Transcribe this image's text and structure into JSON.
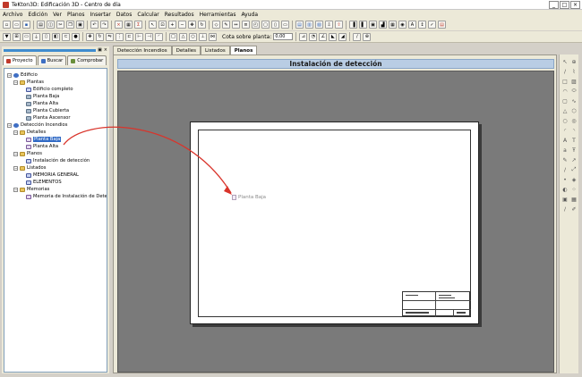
{
  "window": {
    "title": "TeKton3D: Edificación 3D - Centro de día",
    "buttons": [
      "_",
      "□",
      "×"
    ]
  },
  "menu": [
    "Archivo",
    "Edición",
    "Ver",
    "Planos",
    "Insertar",
    "Datos",
    "Calcular",
    "Resultados",
    "Herramientas",
    "Ayuda"
  ],
  "toolbar": {
    "cota_label": "Cota sobre planta:",
    "cota_value": "0,00"
  },
  "left_panel": {
    "tabs": [
      "Proyecto",
      "Buscar",
      "Comprobar"
    ],
    "tree": [
      {
        "label": "Edificio"
      },
      {
        "label": "Plantas"
      },
      {
        "label": "Edificio completo"
      },
      {
        "label": "Planta Baja"
      },
      {
        "label": "Planta Alta"
      },
      {
        "label": "Planta Cubierta"
      },
      {
        "label": "Planta Ascensor"
      },
      {
        "label": "Detección Incendios"
      },
      {
        "label": "Detalles"
      },
      {
        "label": "Planta Baja"
      },
      {
        "label": "Planta Alta"
      },
      {
        "label": "Planos"
      },
      {
        "label": "Instalación de detección"
      },
      {
        "label": "Listados"
      },
      {
        "label": "MEMORIA GENERAL"
      },
      {
        "label": "ELEMENTOS"
      },
      {
        "label": "Memorias"
      },
      {
        "label": "Memoria de Instalación de Dete"
      }
    ]
  },
  "doc_tabs": [
    "Detección Incendios",
    "Detalles",
    "Listados",
    "Planos"
  ],
  "main": {
    "title": "Instalación de detección",
    "plan_label": "Planta Baja"
  },
  "colors": {
    "accent": "#316ac5",
    "arrow": "#d9342b",
    "canvas": "#7a7a7a"
  }
}
